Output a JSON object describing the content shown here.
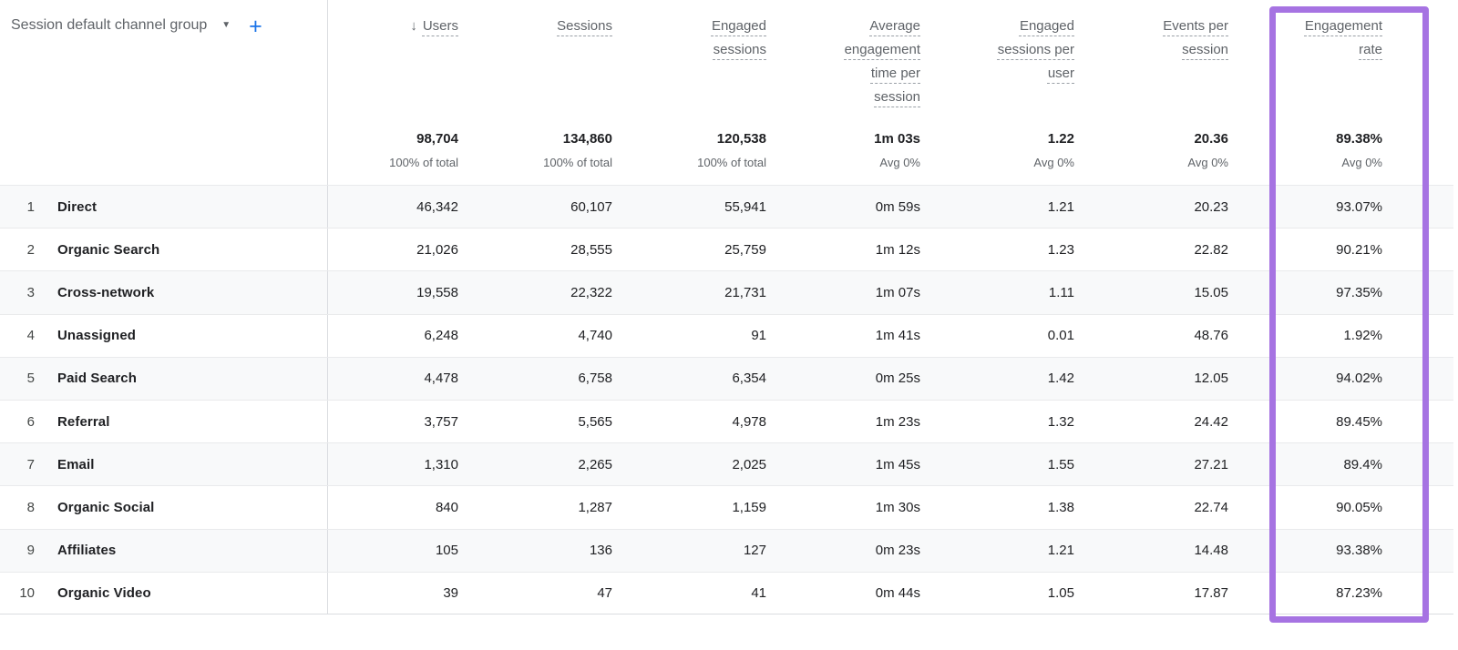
{
  "dimension_header": {
    "label": "Session default channel group",
    "caret_icon": "▼",
    "add_icon": "+"
  },
  "sort": {
    "column": "Users",
    "direction": "descending",
    "icon": "↓"
  },
  "columns": [
    {
      "id": "users",
      "label": "Users",
      "sorted": true
    },
    {
      "id": "sessions",
      "label": "Sessions"
    },
    {
      "id": "engaged-sessions",
      "label": "Engaged sessions"
    },
    {
      "id": "avg-engagement-time-per-session",
      "label": "Average engagement time per session"
    },
    {
      "id": "engaged-sessions-per-user",
      "label": "Engaged sessions per user"
    },
    {
      "id": "events-per-session",
      "label": "Events per session"
    },
    {
      "id": "engagement-rate",
      "label": "Engagement rate",
      "highlighted": true
    }
  ],
  "totals": {
    "values": [
      "98,704",
      "134,860",
      "120,538",
      "1m 03s",
      "1.22",
      "20.36",
      "89.38%"
    ],
    "subtexts": [
      "100% of total",
      "100% of total",
      "100% of total",
      "Avg 0%",
      "Avg 0%",
      "Avg 0%",
      "Avg 0%"
    ]
  },
  "rows": [
    {
      "rank": "1",
      "channel": "Direct",
      "values": [
        "46,342",
        "60,107",
        "55,941",
        "0m 59s",
        "1.21",
        "20.23",
        "93.07%"
      ]
    },
    {
      "rank": "2",
      "channel": "Organic Search",
      "values": [
        "21,026",
        "28,555",
        "25,759",
        "1m 12s",
        "1.23",
        "22.82",
        "90.21%"
      ]
    },
    {
      "rank": "3",
      "channel": "Cross-network",
      "values": [
        "19,558",
        "22,322",
        "21,731",
        "1m 07s",
        "1.11",
        "15.05",
        "97.35%"
      ]
    },
    {
      "rank": "4",
      "channel": "Unassigned",
      "values": [
        "6,248",
        "4,740",
        "91",
        "1m 41s",
        "0.01",
        "48.76",
        "1.92%"
      ]
    },
    {
      "rank": "5",
      "channel": "Paid Search",
      "values": [
        "4,478",
        "6,758",
        "6,354",
        "0m 25s",
        "1.42",
        "12.05",
        "94.02%"
      ]
    },
    {
      "rank": "6",
      "channel": "Referral",
      "values": [
        "3,757",
        "5,565",
        "4,978",
        "1m 23s",
        "1.32",
        "24.42",
        "89.45%"
      ]
    },
    {
      "rank": "7",
      "channel": "Email",
      "values": [
        "1,310",
        "2,265",
        "2,025",
        "1m 45s",
        "1.55",
        "27.21",
        "89.4%"
      ]
    },
    {
      "rank": "8",
      "channel": "Organic Social",
      "values": [
        "840",
        "1,287",
        "1,159",
        "1m 30s",
        "1.38",
        "22.74",
        "90.05%"
      ]
    },
    {
      "rank": "9",
      "channel": "Affiliates",
      "values": [
        "105",
        "136",
        "127",
        "0m 23s",
        "1.21",
        "14.48",
        "93.38%"
      ]
    },
    {
      "rank": "10",
      "channel": "Organic Video",
      "values": [
        "39",
        "47",
        "41",
        "0m 44s",
        "1.05",
        "17.87",
        "87.23%"
      ]
    }
  ],
  "colors": {
    "highlight_purple": "#a673e2",
    "add_button_blue": "#1a73e8",
    "header_text_gray": "#5f6368",
    "row_stripe": "#f8f9fa"
  }
}
